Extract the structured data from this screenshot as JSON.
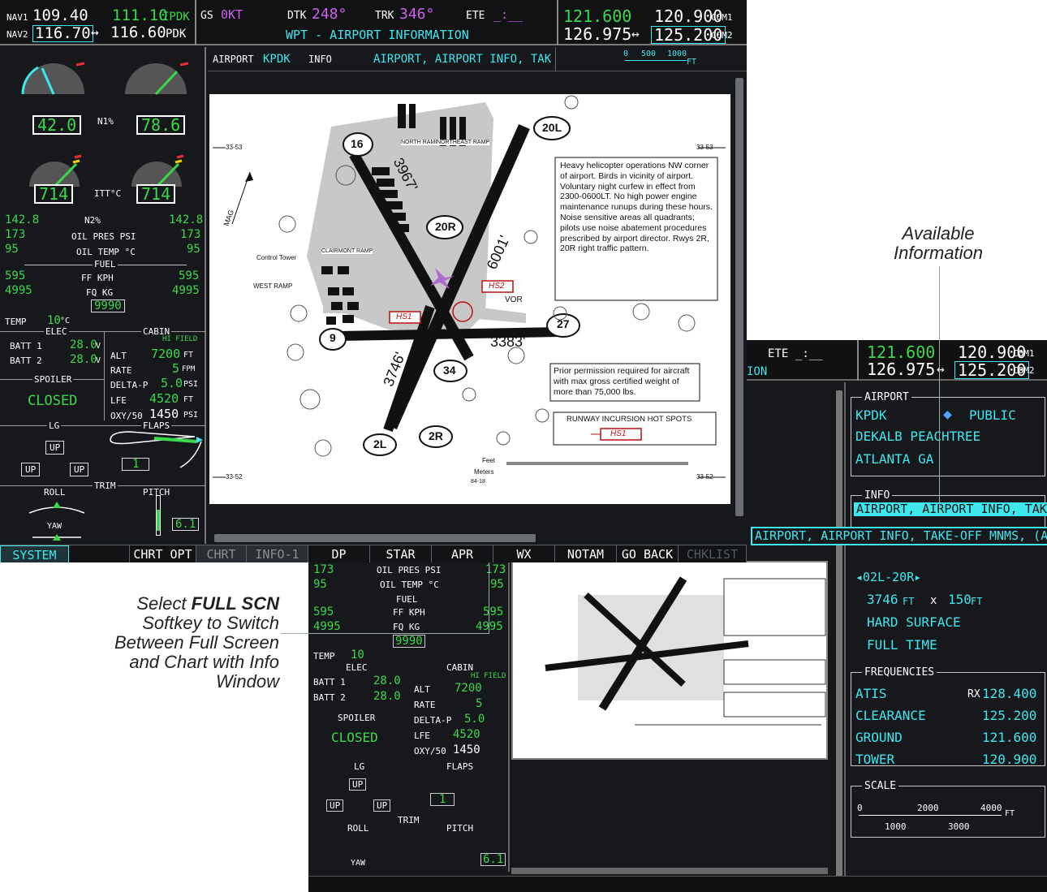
{
  "nav": {
    "nav1_label": "NAV1",
    "nav1_active": "109.40",
    "nav1_standby": "111.10",
    "nav1_id": "IPDK",
    "nav2_label": "NAV2",
    "nav2_active": "116.70",
    "nav2_arrow": "↔",
    "nav2_standby": "116.60",
    "nav2_id": "PDK"
  },
  "status": {
    "gs_label": "GS",
    "gs_value": "0KT",
    "dtk_label": "DTK",
    "dtk_value": "248°",
    "trk_label": "TRK",
    "trk_value": "346°",
    "ete_label": "ETE",
    "ete_value": "_:__",
    "page_title": "WPT - AIRPORT INFORMATION"
  },
  "com": {
    "com1_active": "121.600",
    "com1_standby": "120.900",
    "com1_label": "COM1",
    "com2_active": "126.975",
    "com2_arrow": "↔",
    "com2_standby": "125.200",
    "com2_label": "COM2"
  },
  "chart_header": {
    "airport_label": "AIRPORT",
    "airport_id": "KPDK",
    "info_label": "INFO",
    "info_value": "AIRPORT, AIRPORT INFO, TAK",
    "scale_0": "0",
    "scale_500": "500",
    "scale_1000": "1000",
    "scale_unit": "FT"
  },
  "engine": {
    "n1_left": "42.0",
    "n1_label": "N1%",
    "n1_right": "78.6",
    "itt_left": "714",
    "itt_label": "ITT°C",
    "itt_right": "714",
    "n2_left": "142.8",
    "n2_label": "N2%",
    "n2_right": "142.8",
    "oilp_left": "173",
    "oilp_label": "OIL PRES PSI",
    "oilp_right": "173",
    "oilt_left": "95",
    "oilt_label": "OIL TEMP °C",
    "oilt_right": "95",
    "fuel_label": "FUEL",
    "ff_left": "595",
    "ff_label": "FF KPH",
    "ff_right": "595",
    "fq_left": "4995",
    "fq_label": "FQ KG",
    "fq_right": "4995",
    "fuel_total": "9990",
    "temp_label": "TEMP",
    "temp_value": "10",
    "temp_unit": "°C",
    "elec_label": "ELEC",
    "batt1_label": "BATT 1",
    "batt1_value": "28.0",
    "batt2_label": "BATT 2",
    "batt2_value": "28.0",
    "volt_unit": "V",
    "cabin_label": "CABIN",
    "hi_field": "HI FIELD",
    "alt_label": "ALT",
    "alt_value": "7200",
    "ft_unit": "FT",
    "rate_label": "RATE",
    "rate_value": "5",
    "fpm_unit": "FPM",
    "deltap_label": "DELTA-P",
    "deltap_value": "5.0",
    "psi_unit": "PSI",
    "lfe_label": "LFE",
    "lfe_value": "4520",
    "oxy_label": "OXY/50",
    "oxy_value": "1450",
    "spoiler_label": "SPOILER",
    "spoiler_state": "CLOSED",
    "lg_label": "LG",
    "flaps_label": "FLAPS",
    "up_label": "UP",
    "flaps_value": "1",
    "trim_label": "TRIM",
    "roll_label": "ROLL",
    "pitch_label": "PITCH",
    "yaw_label": "YAW",
    "pitch_value": "6.1"
  },
  "softkeys": [
    "SYSTEM",
    "",
    "CHRT OPT",
    "CHRT",
    "INFO-1",
    "DP",
    "STAR",
    "APR",
    "WX",
    "NOTAM",
    "GO BACK",
    "CHKLIST"
  ],
  "info_panel": {
    "airport_section": "AIRPORT",
    "airport_id": "KPDK",
    "airport_type": "PUBLIC",
    "airport_name": "DEKALB PEACHTREE",
    "airport_city": "ATLANTA GA",
    "info_section": "INFO",
    "info_value": "AIRPORT, AIRPORT INFO, TAK",
    "dropdown_option": "AIRPORT, AIRPORT INFO, TAKE-OFF MNMS, (APT)",
    "runway_id": "02L-20R",
    "runway_length": "3746",
    "runway_x": "x",
    "runway_width": "150",
    "runway_surface": "HARD SURFACE",
    "runway_hours": "FULL TIME",
    "freq_section": "FREQUENCIES",
    "freqs": [
      {
        "name": "ATIS",
        "rx": "RX",
        "value": "128.400"
      },
      {
        "name": "CLEARANCE",
        "rx": "",
        "value": "125.200"
      },
      {
        "name": "GROUND",
        "rx": "",
        "value": "121.600"
      },
      {
        "name": "TOWER",
        "rx": "",
        "value": "120.900"
      }
    ],
    "scale_section": "SCALE",
    "scale_0": "0",
    "scale_2000": "2000",
    "scale_4000": "4000",
    "scale_unit": "FT",
    "scale_1000": "1000",
    "scale_3000": "3000"
  },
  "chart": {
    "heli_note": "Heavy helicopter operations NW corner of airport. Birds in vicinity of airport. Voluntary night curfew in effect from 2300-0600LT. No high power engine maintenance runups during these hours. Noise sensitive areas all quadrants; pilots use noise abatement procedures prescribed by airport director. Rwys 2R, 20R right traffic pattern.",
    "prior_note": "Prior permission required for aircraft with max gross certified weight of more than 75,000 lbs.",
    "hotspot_title": "RUNWAY INCURSION HOT SPOTS",
    "hs1": "HS1",
    "hs2": "HS2",
    "rwy_20L": "20L",
    "rwy_16": "16",
    "rwy_20R": "20R",
    "rwy_27": "27",
    "rwy_9": "9",
    "rwy_34": "34",
    "rwy_2L": "2L",
    "rwy_2R": "2R",
    "dim_3967": "3967'",
    "dim_6001": "6001'",
    "dim_3383": "3383'",
    "dim_3746": "3746'",
    "vor": "VOR",
    "control_tower": "Control Tower",
    "west_ramp": "WEST RAMP",
    "north_ramp": "NORTH RAMP",
    "ne_ramp": "NORTHEAST RAMP",
    "claremont": "CLAIRMONT RAMP",
    "lat1": "33-53",
    "lat2": "33-52",
    "feet": "Feet",
    "meters": "Meters",
    "mag": "MAG",
    "code": "84-18"
  },
  "callouts": {
    "available": "Available Information",
    "fullscn_1": "Select ",
    "fullscn_bold": "FULL SCN",
    "fullscn_2": "Softkey to Switch Between Full Screen and Chart with Info Window"
  }
}
